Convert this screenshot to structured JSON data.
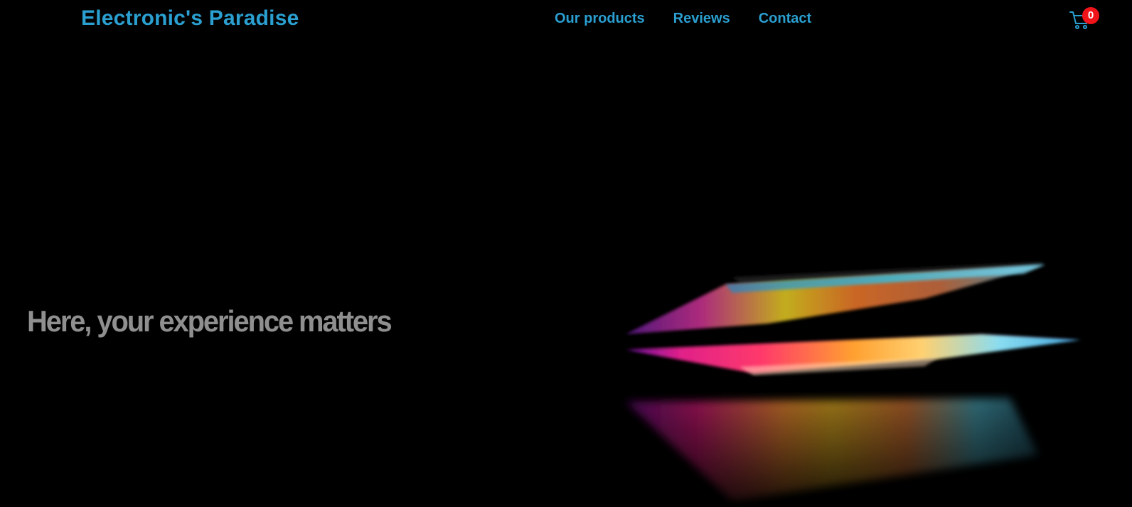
{
  "header": {
    "brand": "Electronic's Paradise",
    "nav": [
      {
        "label": "Our products"
      },
      {
        "label": "Reviews"
      },
      {
        "label": "Contact"
      }
    ],
    "cart": {
      "count": "0",
      "icon": "cart-icon",
      "badge_color": "#f0141a"
    }
  },
  "hero": {
    "tagline": "Here, your experience matters",
    "image": "laptop-image"
  },
  "colors": {
    "accent": "#2a9fd0",
    "background": "#000000",
    "tagline": "#8f8f8f"
  }
}
